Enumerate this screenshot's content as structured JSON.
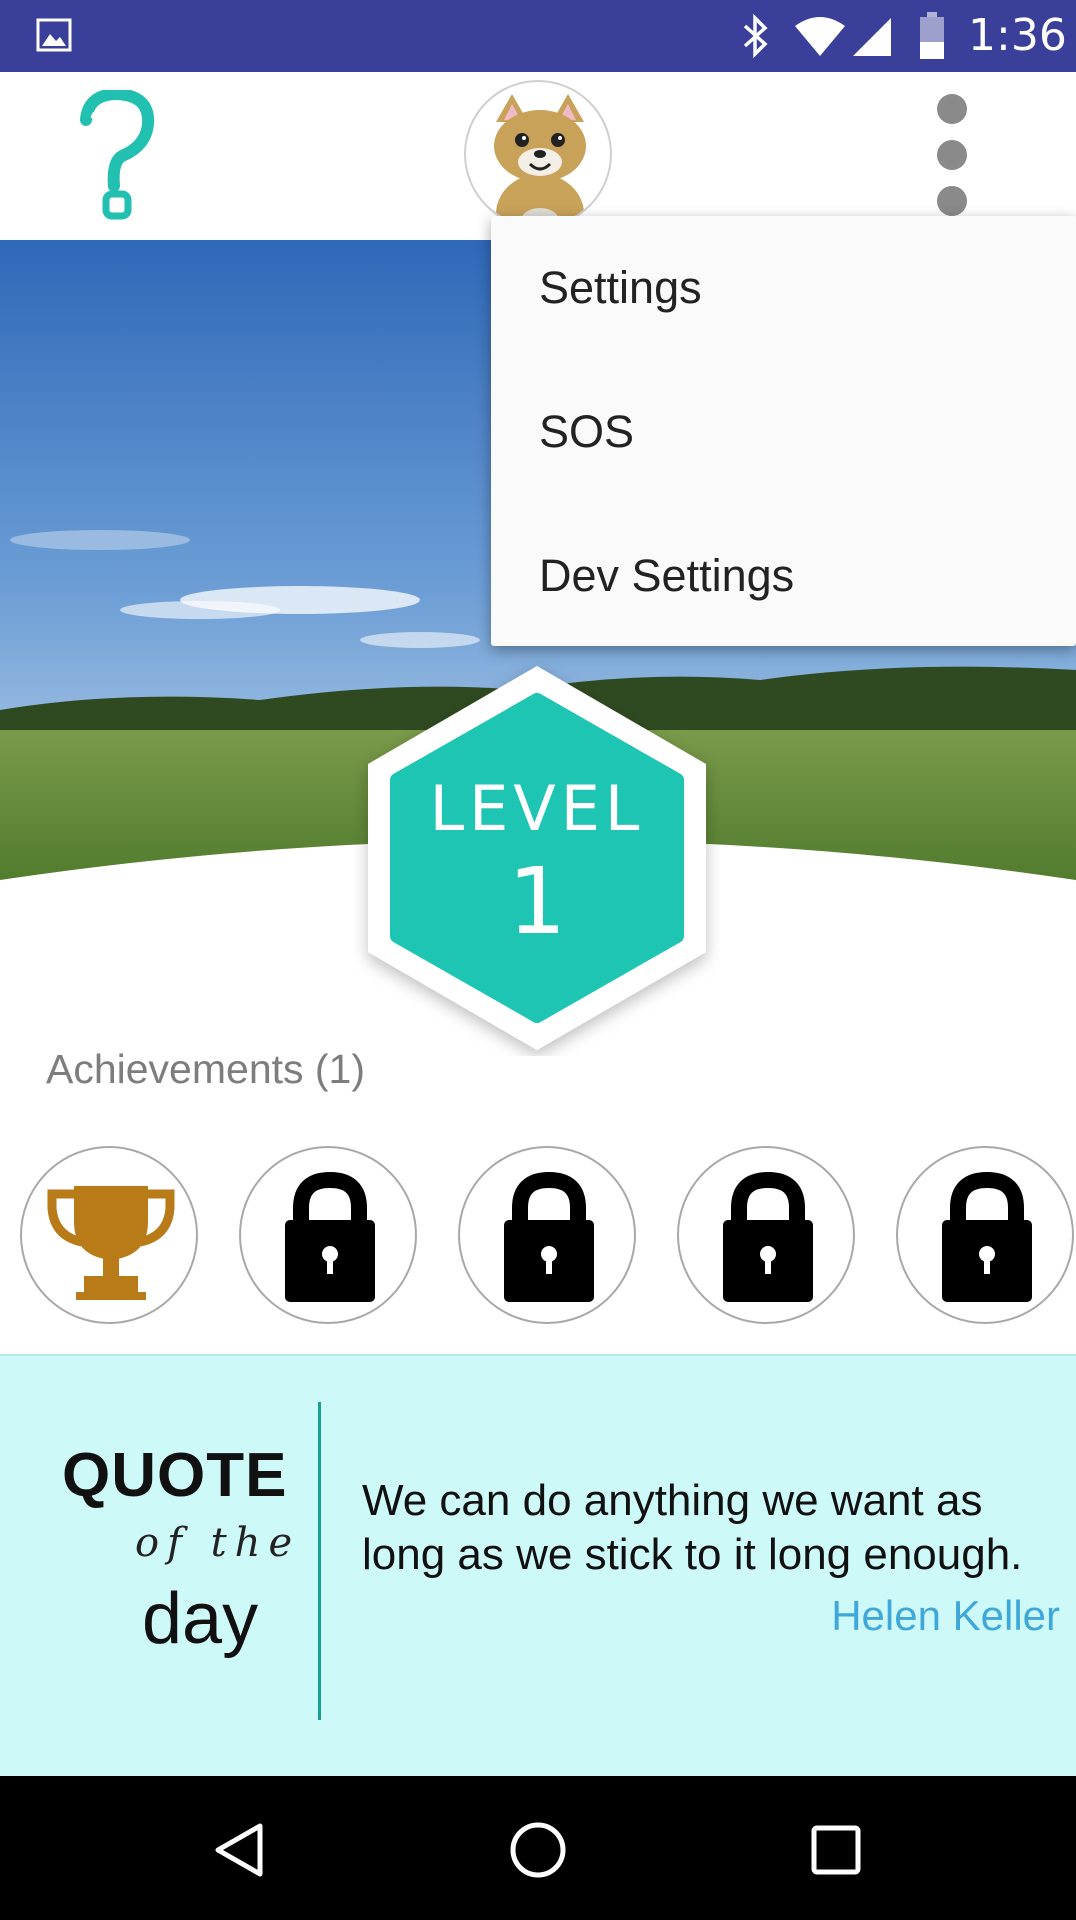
{
  "status_bar": {
    "time": "1:36",
    "icons": [
      "image-icon",
      "bluetooth-icon",
      "wifi-icon",
      "signal-icon",
      "battery-icon"
    ]
  },
  "app_bar": {
    "left_icon": "question-mark-icon",
    "avatar": "cat-avatar",
    "right_icon": "more-vert-icon"
  },
  "overflow_menu": {
    "items": [
      {
        "label": "Settings"
      },
      {
        "label": "SOS"
      },
      {
        "label": "Dev Settings"
      }
    ]
  },
  "level": {
    "label": "LEVEL",
    "value": "1"
  },
  "achievements": {
    "title": "Achievements (1)",
    "badges": [
      {
        "state": "unlocked",
        "icon": "trophy-icon"
      },
      {
        "state": "locked",
        "icon": "lock-icon"
      },
      {
        "state": "locked",
        "icon": "lock-icon"
      },
      {
        "state": "locked",
        "icon": "lock-icon"
      },
      {
        "state": "locked",
        "icon": "lock-icon"
      }
    ]
  },
  "quote": {
    "heading_line1": "QUOTE",
    "heading_line2": "of the",
    "heading_line3": "day",
    "text": "We can do anything we want as long as we stick to it long enough.",
    "author": "Helen Keller"
  },
  "nav_bar": {
    "buttons": [
      "back-icon",
      "home-icon",
      "recents-icon"
    ]
  },
  "colors": {
    "status_bar": "#3a3f99",
    "accent_teal": "#1dc5b2",
    "quote_background": "#cdfaf8",
    "author_link": "#3fa7d9",
    "trophy": "#b97a18"
  }
}
